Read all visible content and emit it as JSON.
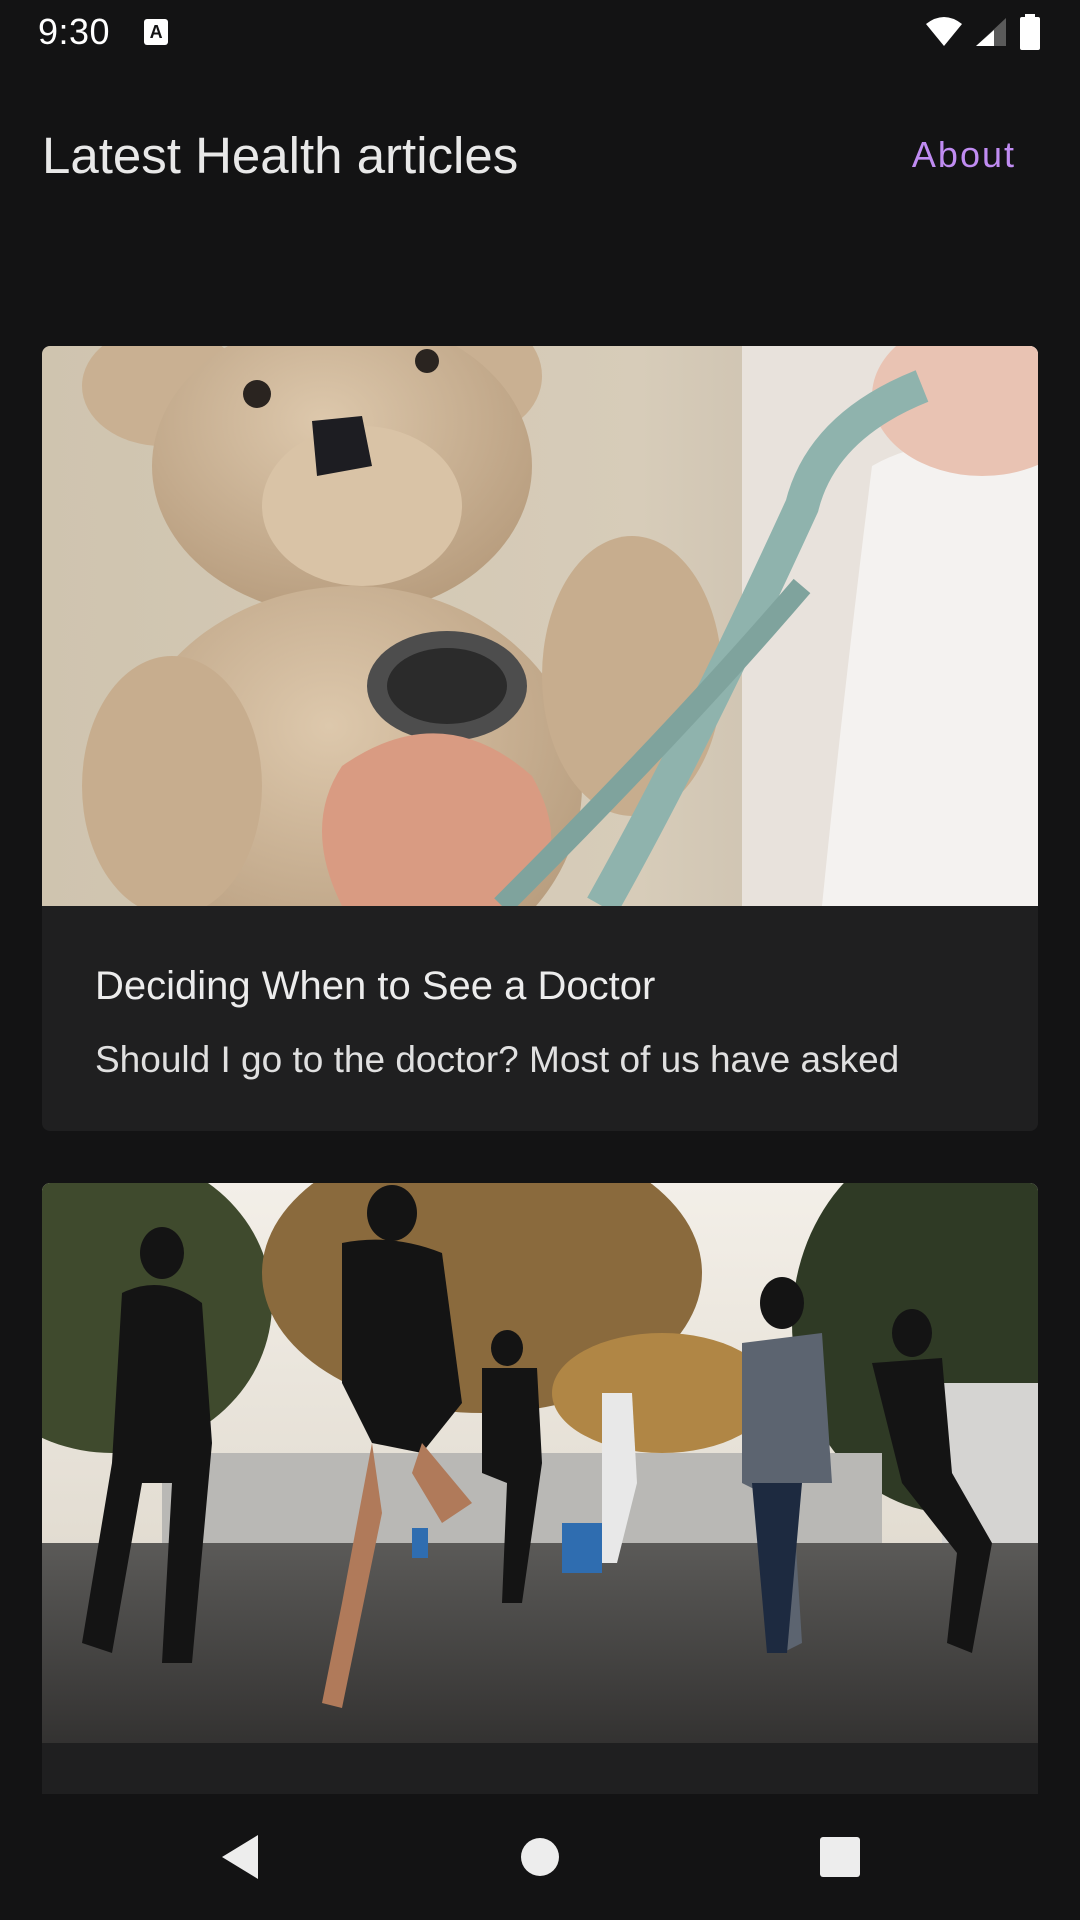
{
  "status_bar": {
    "time": "9:30",
    "notification_icon": "a-badge-icon",
    "icons": [
      "wifi-icon",
      "cellular-signal-icon",
      "battery-icon"
    ]
  },
  "header": {
    "title": "Latest Health articles",
    "about_label": "About",
    "accent_color": "#c08cf2"
  },
  "articles": [
    {
      "image": "teddy-bear-stethoscope-photo",
      "title": "Deciding When to See a Doctor",
      "snippet": "Should I go to the doctor? Most of us have asked"
    },
    {
      "image": "group-exercise-outdoors-photo",
      "title": "",
      "snippet": ""
    }
  ],
  "navigation": {
    "icons": [
      "back-icon",
      "home-icon",
      "recents-icon"
    ]
  },
  "colors": {
    "background": "#131314",
    "card": "#1f1f20"
  }
}
